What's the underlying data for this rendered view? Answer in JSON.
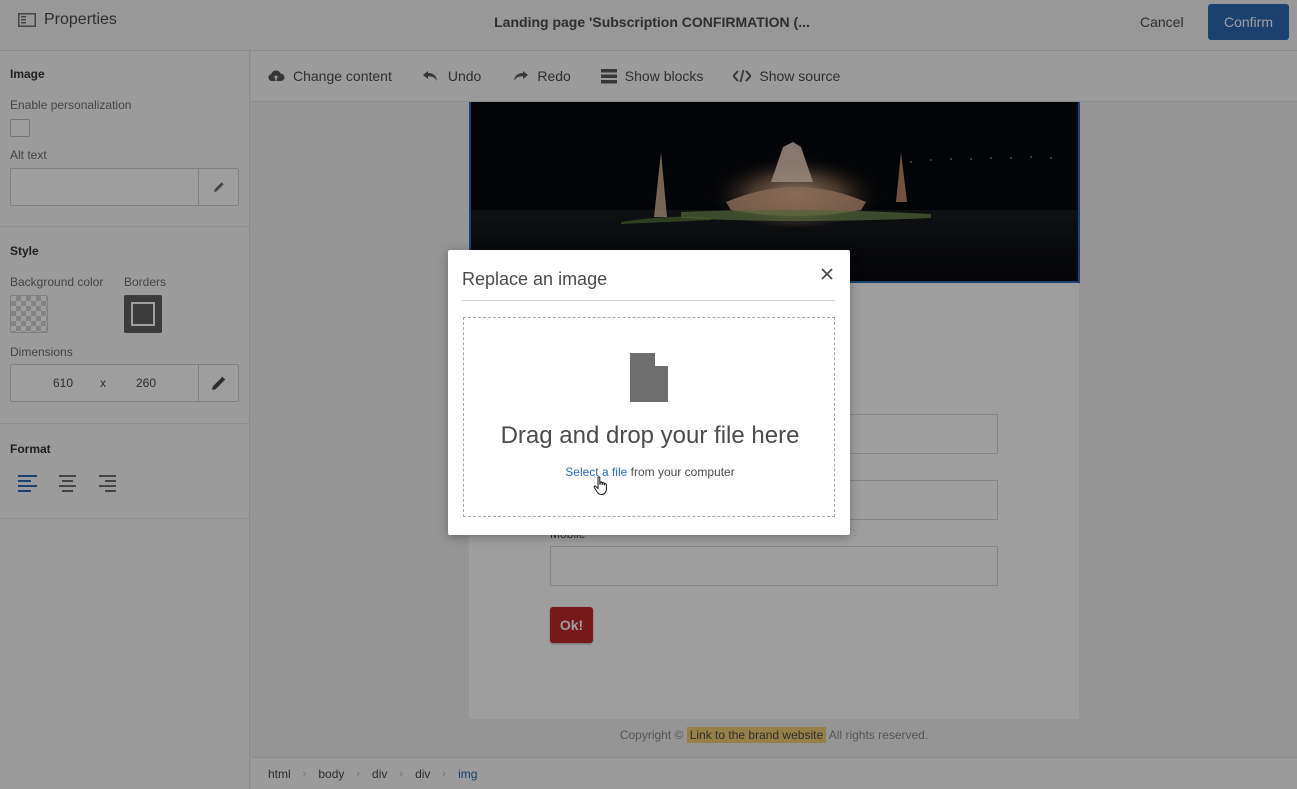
{
  "topbar": {
    "panel_title": "Properties",
    "doc_title": "Landing page 'Subscription CONFIRMATION (...",
    "cancel_label": "Cancel",
    "confirm_label": "Confirm"
  },
  "panel": {
    "image_section": "Image",
    "enable_personalization": "Enable personalization",
    "alt_text_label": "Alt text",
    "alt_text_value": "",
    "style_section": "Style",
    "background_color_label": "Background color",
    "borders_label": "Borders",
    "dimensions_label": "Dimensions",
    "width": "610",
    "separator": "x",
    "height": "260",
    "format_section": "Format"
  },
  "toolbar": {
    "change_content": "Change content",
    "undo": "Undo",
    "redo": "Redo",
    "show_blocks": "Show blocks",
    "show_source": "Show source"
  },
  "page": {
    "mobile_label": "Mobile",
    "ok_label": "Ok!",
    "copyright_prefix": "Copyright ©",
    "brand_link": "Link to the brand website",
    "copyright_suffix": "All rights reserved."
  },
  "breadcrumb": [
    "html",
    "body",
    "div",
    "div",
    "img"
  ],
  "modal": {
    "title": "Replace an image",
    "drop_text": "Drag and drop your file here",
    "select_link": "Select a file",
    "select_suffix": "from your computer"
  },
  "colors": {
    "accent": "#2c6ab6",
    "ok_button": "#c1272d",
    "brand_highlight": "#f3cf73"
  }
}
